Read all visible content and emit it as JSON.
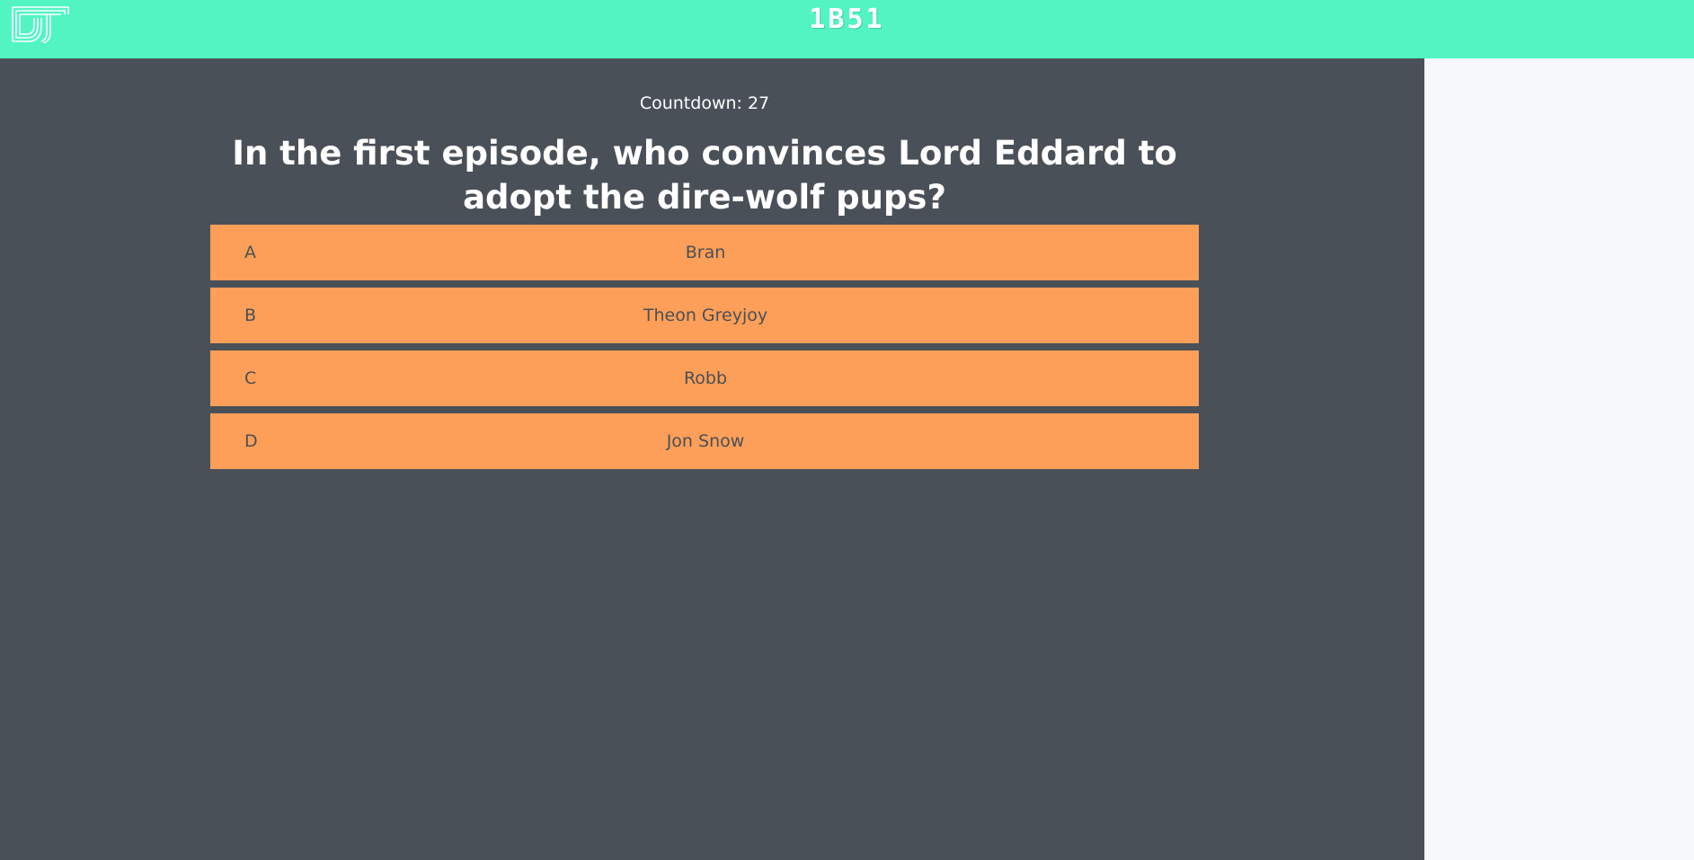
{
  "header": {
    "logo_icon": "dt-logo-icon",
    "game_code": "1B51",
    "accent_color": "#52f5c2"
  },
  "game": {
    "countdown_label": "Countdown:",
    "countdown_value": "27",
    "question": "In the first episode, who convinces Lord Eddard to adopt the dire-wolf pups?",
    "answers": [
      {
        "letter": "A",
        "text": "Bran"
      },
      {
        "letter": "B",
        "text": "Theon Greyjoy"
      },
      {
        "letter": "C",
        "text": "Robb"
      },
      {
        "letter": "D",
        "text": "Jon Snow"
      }
    ],
    "answer_color": "#fd9f58",
    "background_color": "#4a5058"
  }
}
